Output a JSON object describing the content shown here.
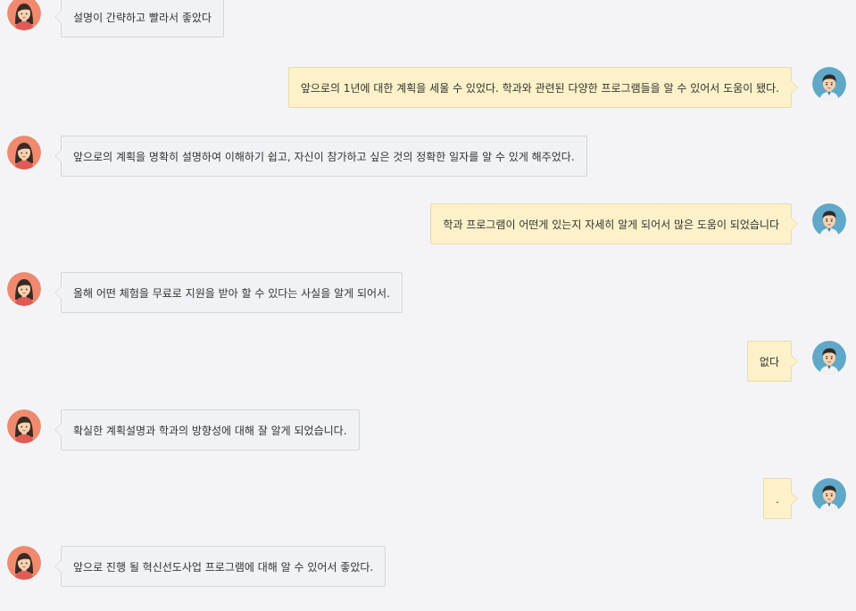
{
  "messages": [
    {
      "side": "left",
      "text": "설명이 간략하고 빨라서 좋았다"
    },
    {
      "side": "right",
      "text": "앞으로의 1년에 대한 계획을 세울 수 있었다. 학과와 관련된 다양한 프로그램들을 알 수 있어서 도움이 됐다."
    },
    {
      "side": "left",
      "text": "앞으로의 계획을 명확히 설명하여 이해하기 쉽고, 자신이 참가하고 싶은 것의 정확한 일자를 알 수 있게 해주었다."
    },
    {
      "side": "right",
      "text": "학과 프로그램이 어떤게 있는지 자세히 알게 되어서 많은 도움이 되었습니다"
    },
    {
      "side": "left",
      "text": "올해 어떤 체험을 무료로 지원을 받아 할 수 있다는 사실을 알게 되어서."
    },
    {
      "side": "right",
      "text": "없다"
    },
    {
      "side": "left",
      "text": "확실한 계획설명과 학과의 방향성에 대해 잘 알게 되었습니다."
    },
    {
      "side": "right",
      "text": "."
    },
    {
      "side": "left",
      "text": "앞으로 진행 될 혁신선도사업 프로그램에 대해 알 수 있어서 좋았다."
    }
  ],
  "colors": {
    "background": "#f4f4f6",
    "left_bubble": "#f1f2f6",
    "right_bubble": "#fcf1c8",
    "female_avatar_bg": "#ef8a6f",
    "male_avatar_bg": "#5fa8c8"
  },
  "icons": {
    "left_avatar": "female-avatar-icon",
    "right_avatar": "male-avatar-icon"
  }
}
